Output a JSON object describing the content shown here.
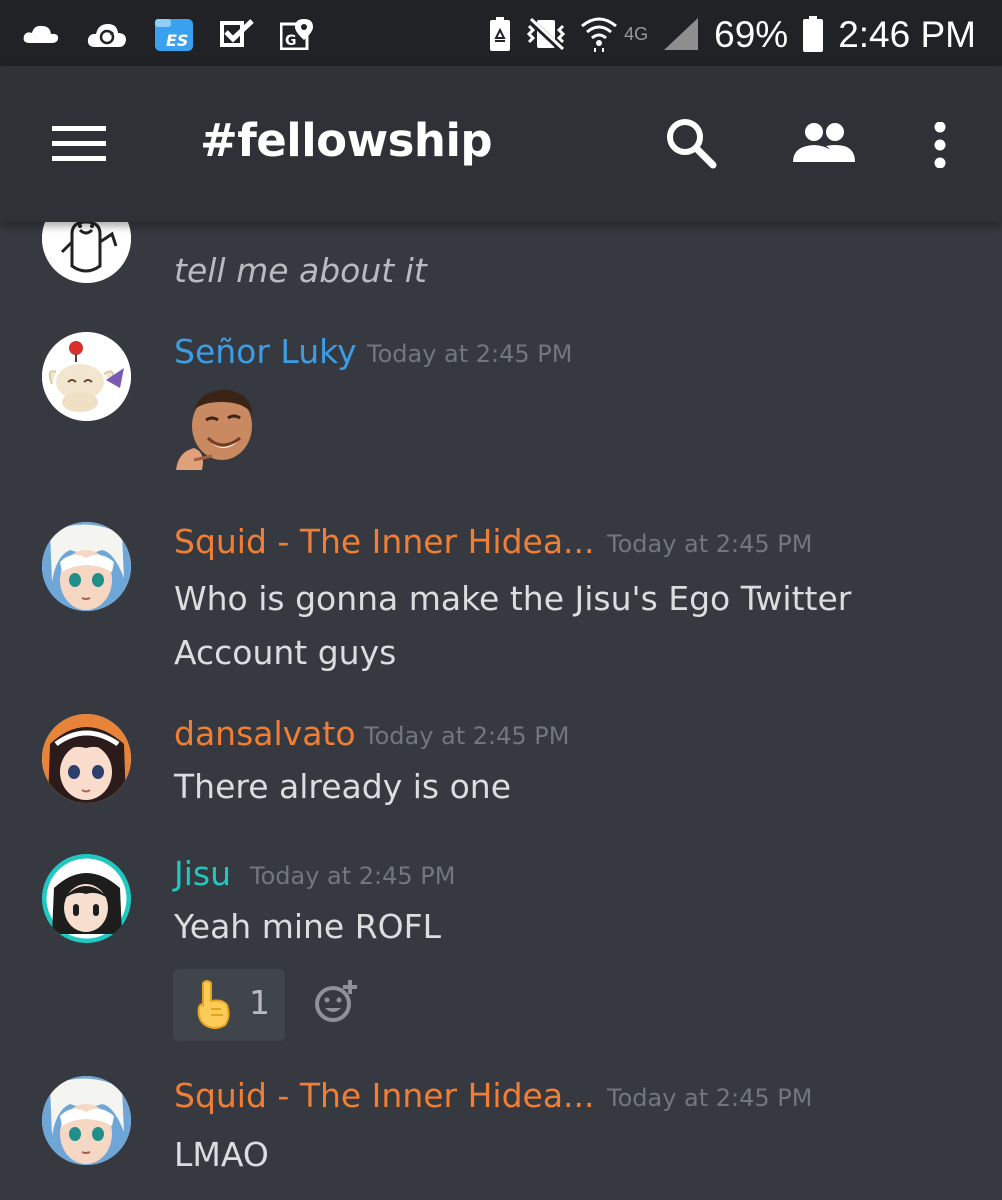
{
  "statusbar": {
    "battery": "69%",
    "time": "2:46 PM",
    "network": "4G",
    "icons": [
      "cloud-icon",
      "sync-cloud-icon",
      "es-file-explorer-icon",
      "checkbox-icon",
      "maps-icon",
      "battery-saver-icon",
      "vibrate-icon",
      "wifi-icon",
      "signal-icon",
      "battery-icon"
    ]
  },
  "toolbar": {
    "channel": "#fellowship",
    "icons": [
      "hamburger-menu-icon",
      "search-icon",
      "members-icon",
      "overflow-menu-icon"
    ]
  },
  "colors": {
    "background": "#36393f",
    "toolbar": "#2f3136",
    "statusbar": "#202225",
    "orange": "#f07e35",
    "blue": "#3c9ce4",
    "teal": "#1fc8c0",
    "timestamp": "#72767d"
  },
  "messages": [
    {
      "author": "",
      "timestamp": "",
      "text": "tell me about it",
      "style": "italic"
    },
    {
      "author": "Señor Luky",
      "timestamp": "Today at 2:45 PM",
      "text": "",
      "attachment": "laughing-man-emote"
    },
    {
      "author": "Squid - The Inner Hidea...",
      "timestamp": "Today at 2:45 PM",
      "text": "Who is gonna make the Jisu's Ego Twitter\nAccount guys"
    },
    {
      "author": "dansalvato",
      "timestamp": "Today at 2:45 PM",
      "text": "There already is one"
    },
    {
      "author": "Jisu",
      "timestamp": "Today at 2:45 PM",
      "text": "Yeah mine ROFL",
      "reaction": {
        "emoji": "pointing-up-hand",
        "count": "1"
      }
    },
    {
      "author": "Squid - The Inner Hidea...",
      "timestamp": "Today at 2:45 PM",
      "text": "LMAO"
    }
  ]
}
